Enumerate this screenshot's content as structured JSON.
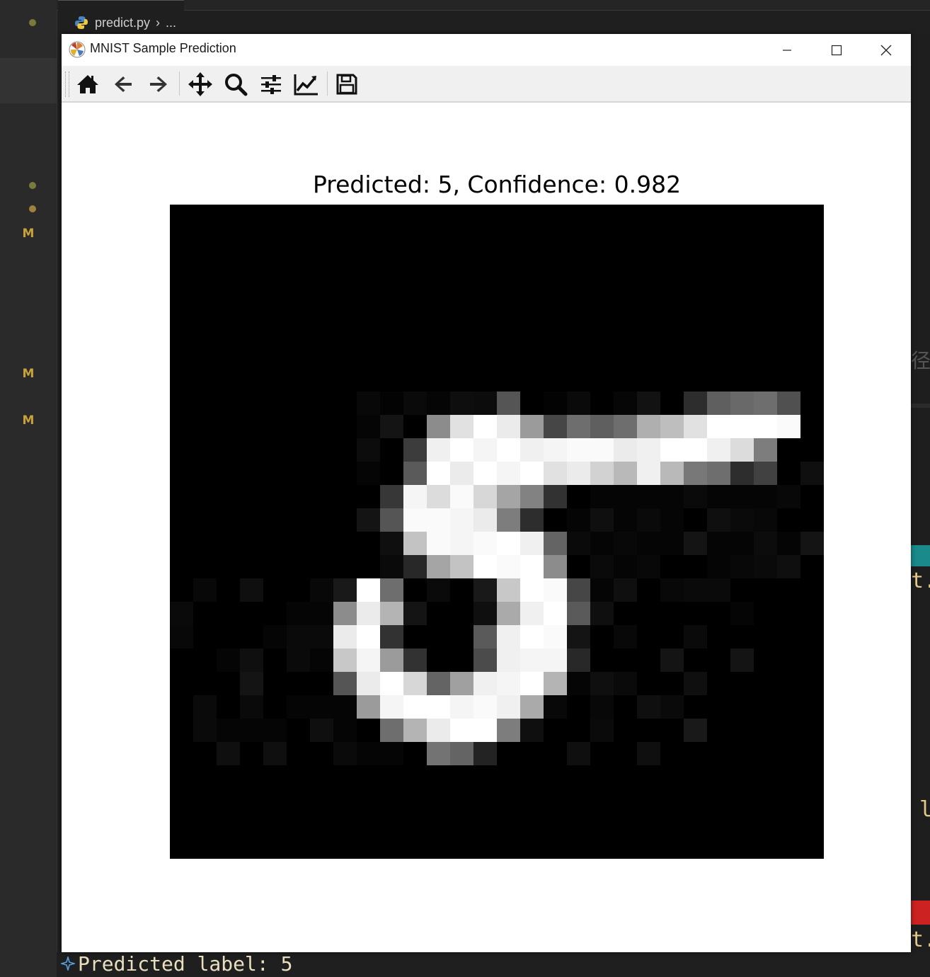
{
  "editor": {
    "breadcrumb_file": "predict.py",
    "breadcrumb_rest": "...",
    "gutter_marks": [
      "M",
      "M",
      "M"
    ],
    "peek_text_1": "t.",
    "peek_text_2": "l",
    "peek_text_3": "t.",
    "peek_glyph": "径",
    "terminal_output": "Predicted label: 5"
  },
  "window": {
    "title": "MNIST Sample Prediction",
    "toolbar": [
      "home-icon",
      "back-icon",
      "forward-icon",
      "pan-icon",
      "zoom-icon",
      "configure-subplots-icon",
      "edit-axis-icon",
      "save-icon"
    ]
  },
  "figure": {
    "title": "Predicted: 5, Confidence: 0.982"
  },
  "colors": {
    "accent_teal": "#1a8a8a",
    "accent_red": "#cc2222",
    "modified": "#c9a23a"
  },
  "chart_data": {
    "type": "heatmap",
    "title": "Predicted: 5, Confidence: 0.982",
    "colormap": "gray",
    "range": [
      0,
      255
    ],
    "size": [
      28,
      28
    ],
    "pixels": [
      [
        0,
        0,
        0,
        0,
        0,
        0,
        0,
        0,
        0,
        0,
        0,
        0,
        0,
        0,
        0,
        0,
        0,
        0,
        0,
        0,
        0,
        0,
        0,
        0,
        0,
        0,
        0,
        0
      ],
      [
        0,
        0,
        0,
        0,
        0,
        0,
        0,
        0,
        0,
        0,
        0,
        0,
        0,
        0,
        0,
        0,
        0,
        0,
        0,
        0,
        0,
        0,
        0,
        0,
        0,
        0,
        0,
        0
      ],
      [
        0,
        0,
        0,
        0,
        0,
        0,
        0,
        0,
        0,
        0,
        0,
        0,
        0,
        0,
        0,
        0,
        0,
        0,
        0,
        0,
        0,
        0,
        0,
        0,
        0,
        0,
        0,
        0
      ],
      [
        0,
        0,
        0,
        0,
        0,
        0,
        0,
        0,
        0,
        0,
        0,
        0,
        0,
        0,
        0,
        0,
        0,
        0,
        0,
        0,
        0,
        0,
        0,
        0,
        0,
        0,
        0,
        0
      ],
      [
        0,
        0,
        0,
        0,
        0,
        0,
        0,
        0,
        0,
        0,
        0,
        0,
        0,
        0,
        0,
        0,
        0,
        0,
        0,
        0,
        0,
        0,
        0,
        0,
        0,
        0,
        0,
        0
      ],
      [
        0,
        0,
        0,
        0,
        0,
        0,
        0,
        0,
        0,
        0,
        0,
        0,
        0,
        0,
        0,
        0,
        0,
        0,
        0,
        0,
        0,
        0,
        0,
        0,
        0,
        0,
        0,
        0
      ],
      [
        0,
        0,
        0,
        0,
        0,
        0,
        0,
        0,
        0,
        0,
        0,
        0,
        0,
        0,
        0,
        0,
        0,
        0,
        0,
        0,
        0,
        0,
        0,
        0,
        0,
        0,
        0,
        0
      ],
      [
        0,
        0,
        0,
        0,
        0,
        0,
        0,
        0,
        0,
        0,
        0,
        0,
        0,
        0,
        0,
        0,
        0,
        0,
        0,
        0,
        0,
        0,
        0,
        0,
        0,
        0,
        0,
        0
      ],
      [
        0,
        0,
        0,
        0,
        0,
        0,
        0,
        0,
        8,
        3,
        10,
        5,
        14,
        12,
        85,
        0,
        3,
        10,
        0,
        6,
        18,
        0,
        45,
        95,
        105,
        110,
        80,
        0
      ],
      [
        0,
        0,
        0,
        0,
        0,
        0,
        0,
        0,
        5,
        20,
        0,
        140,
        225,
        255,
        235,
        155,
        70,
        110,
        95,
        110,
        175,
        190,
        225,
        255,
        255,
        255,
        250,
        0
      ],
      [
        0,
        0,
        0,
        0,
        0,
        0,
        0,
        0,
        12,
        0,
        60,
        240,
        255,
        245,
        255,
        240,
        245,
        250,
        250,
        235,
        240,
        255,
        255,
        240,
        220,
        125,
        0,
        0
      ],
      [
        0,
        0,
        0,
        0,
        0,
        0,
        0,
        0,
        5,
        0,
        90,
        255,
        235,
        255,
        245,
        255,
        225,
        235,
        210,
        185,
        240,
        185,
        120,
        110,
        45,
        65,
        0,
        15
      ],
      [
        0,
        0,
        0,
        0,
        0,
        0,
        0,
        0,
        0,
        55,
        245,
        220,
        250,
        215,
        165,
        130,
        50,
        0,
        5,
        5,
        5,
        5,
        10,
        5,
        5,
        5,
        8,
        0
      ],
      [
        0,
        0,
        0,
        0,
        0,
        0,
        0,
        0,
        20,
        85,
        250,
        250,
        245,
        235,
        125,
        45,
        0,
        5,
        15,
        5,
        10,
        5,
        0,
        15,
        10,
        8,
        0,
        0
      ],
      [
        0,
        0,
        0,
        0,
        0,
        0,
        0,
        0,
        0,
        15,
        195,
        250,
        245,
        250,
        255,
        240,
        100,
        10,
        5,
        8,
        5,
        5,
        20,
        5,
        5,
        12,
        5,
        20
      ],
      [
        0,
        0,
        0,
        0,
        0,
        0,
        0,
        0,
        0,
        10,
        40,
        165,
        195,
        255,
        250,
        255,
        140,
        0,
        10,
        5,
        8,
        0,
        0,
        5,
        8,
        10,
        15,
        0
      ],
      [
        0,
        8,
        0,
        15,
        0,
        0,
        8,
        25,
        255,
        110,
        0,
        10,
        0,
        25,
        200,
        255,
        250,
        70,
        5,
        15,
        0,
        8,
        10,
        10,
        0,
        0,
        0,
        0
      ],
      [
        10,
        0,
        0,
        0,
        0,
        5,
        5,
        140,
        235,
        180,
        20,
        0,
        0,
        15,
        170,
        240,
        255,
        90,
        15,
        0,
        0,
        0,
        0,
        0,
        5,
        0,
        0,
        0
      ],
      [
        8,
        0,
        0,
        0,
        5,
        10,
        10,
        235,
        255,
        50,
        0,
        0,
        0,
        90,
        240,
        255,
        250,
        20,
        0,
        8,
        0,
        0,
        10,
        0,
        0,
        0,
        0,
        0
      ],
      [
        0,
        0,
        5,
        15,
        0,
        10,
        5,
        200,
        245,
        155,
        50,
        0,
        0,
        75,
        240,
        245,
        245,
        40,
        0,
        0,
        0,
        20,
        0,
        0,
        20,
        0,
        0,
        0
      ],
      [
        0,
        0,
        0,
        20,
        0,
        0,
        0,
        85,
        235,
        255,
        215,
        100,
        160,
        240,
        245,
        255,
        180,
        5,
        15,
        10,
        0,
        0,
        15,
        0,
        0,
        0,
        0,
        0
      ],
      [
        0,
        10,
        0,
        10,
        0,
        5,
        5,
        5,
        155,
        245,
        255,
        255,
        245,
        250,
        240,
        170,
        8,
        0,
        8,
        0,
        15,
        10,
        0,
        0,
        0,
        0,
        0,
        0
      ],
      [
        0,
        10,
        5,
        5,
        5,
        0,
        15,
        5,
        0,
        110,
        180,
        235,
        255,
        255,
        125,
        15,
        0,
        0,
        10,
        0,
        0,
        0,
        25,
        0,
        0,
        0,
        0,
        0
      ],
      [
        0,
        0,
        15,
        0,
        15,
        0,
        0,
        10,
        5,
        5,
        0,
        115,
        100,
        35,
        0,
        0,
        0,
        15,
        0,
        0,
        15,
        0,
        0,
        0,
        0,
        0,
        0,
        0
      ],
      [
        0,
        0,
        0,
        0,
        0,
        0,
        0,
        0,
        0,
        0,
        0,
        0,
        0,
        0,
        0,
        0,
        0,
        0,
        0,
        0,
        0,
        0,
        0,
        0,
        0,
        0,
        0,
        0
      ],
      [
        0,
        0,
        0,
        0,
        0,
        0,
        0,
        0,
        0,
        0,
        0,
        0,
        0,
        0,
        0,
        0,
        0,
        0,
        0,
        0,
        0,
        0,
        0,
        0,
        0,
        0,
        0,
        0
      ],
      [
        0,
        0,
        0,
        0,
        0,
        0,
        0,
        0,
        0,
        0,
        0,
        0,
        0,
        0,
        0,
        0,
        0,
        0,
        0,
        0,
        0,
        0,
        0,
        0,
        0,
        0,
        0,
        0
      ],
      [
        0,
        0,
        0,
        0,
        0,
        0,
        0,
        0,
        0,
        0,
        0,
        0,
        0,
        0,
        0,
        0,
        0,
        0,
        0,
        0,
        0,
        0,
        0,
        0,
        0,
        0,
        0,
        0
      ]
    ]
  }
}
